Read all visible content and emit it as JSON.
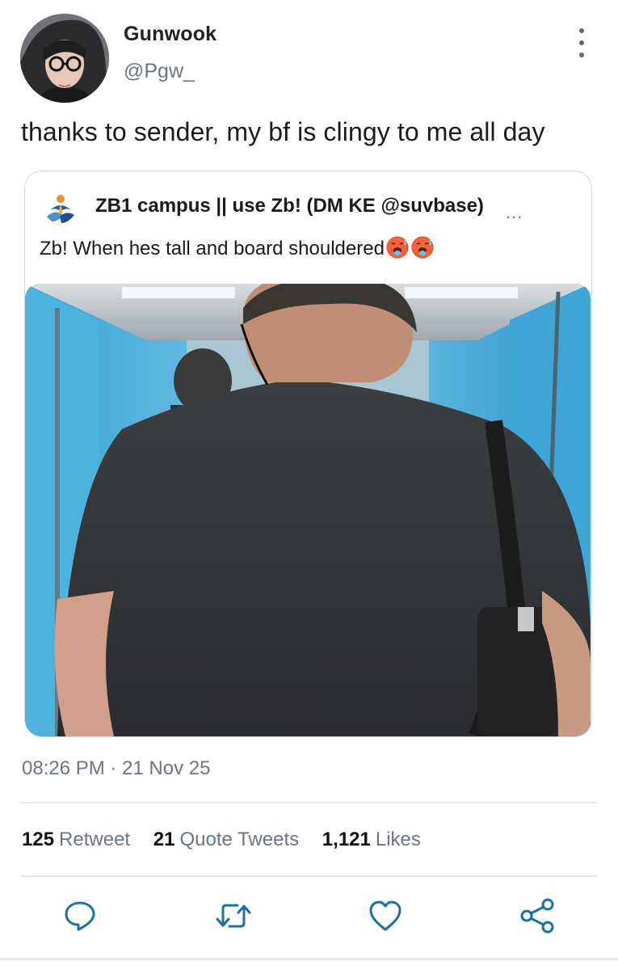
{
  "author": {
    "display_name": "Gunwook",
    "handle": "@Pgw_",
    "avatar_icon": "profile-photo"
  },
  "more_icon": "more-vertical-icon",
  "tweet": {
    "text": "thanks to sender, my bf is clingy to me all day"
  },
  "quoted_tweet": {
    "author_line": "ZB1 campus || use Zb! (DM KE @suvbase)",
    "more_label": "...",
    "text": "Zb! When hes tall and board shouldered",
    "emojis": [
      "hot-face-emoji",
      "hot-face-emoji"
    ],
    "media_icon": "video-thumbnail"
  },
  "meta": {
    "timestamp": "08:26 PM · 21 Nov 25"
  },
  "stats": {
    "retweets": {
      "count": "125",
      "label": "Retweet"
    },
    "quote_tweets": {
      "count": "21",
      "label": "Quote Tweets"
    },
    "likes": {
      "count": "1,121",
      "label": "Likes"
    }
  },
  "actions": [
    "reply-icon",
    "retweet-icon",
    "like-icon",
    "share-icon"
  ],
  "colors": {
    "secondary_text": "#6b7680",
    "primary_text": "#0f1419",
    "border": "#cfd9de",
    "icon_blue": "#1d6fa5"
  }
}
